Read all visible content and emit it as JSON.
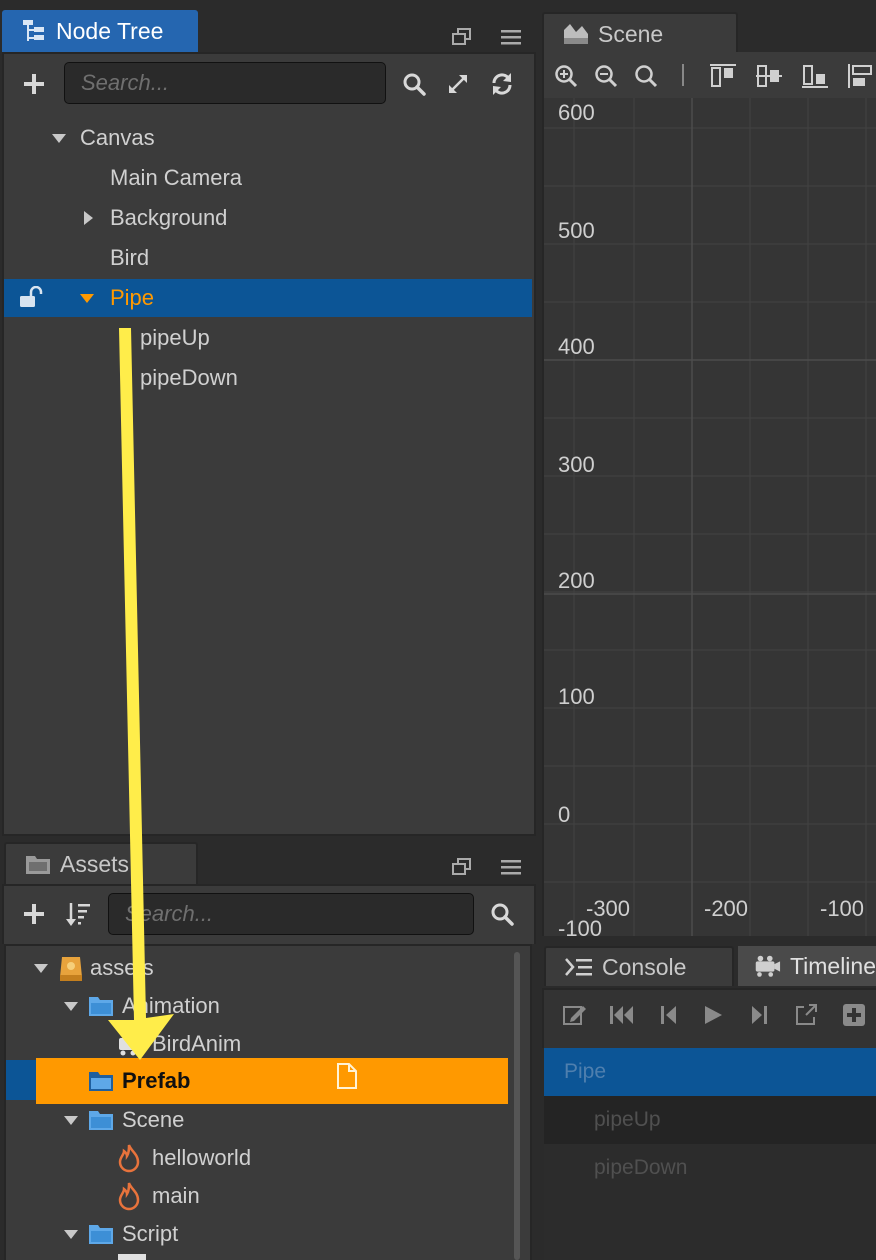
{
  "node_tree": {
    "tab_title": "Node Tree",
    "search_placeholder": "Search...",
    "nodes": [
      "Canvas",
      "Main Camera",
      "Background",
      "Bird",
      "Pipe",
      "pipeUp",
      "pipeDown"
    ]
  },
  "assets": {
    "tab_title": "Assets",
    "search_placeholder": "Search...",
    "items": [
      "assets",
      "Animation",
      "BirdAnim",
      "Prefab",
      "Scene",
      "helloworld",
      "main",
      "Script"
    ]
  },
  "scene": {
    "tab_title": "Scene",
    "y_labels": [
      "600",
      "500",
      "400",
      "300",
      "200",
      "100",
      "0",
      "-100"
    ],
    "x_labels": [
      "-300",
      "-200",
      "-100"
    ]
  },
  "bottom": {
    "console_tab": "Console",
    "timeline_tab": "Timeline",
    "timeline_rows": [
      "Pipe",
      "pipeUp",
      "pipeDown"
    ]
  },
  "colors": {
    "selection_blue": "#0c5596",
    "highlight_orange": "#ff9900",
    "annotation_arrow": "#ffed4a",
    "tab_blue": "#2566b0"
  }
}
